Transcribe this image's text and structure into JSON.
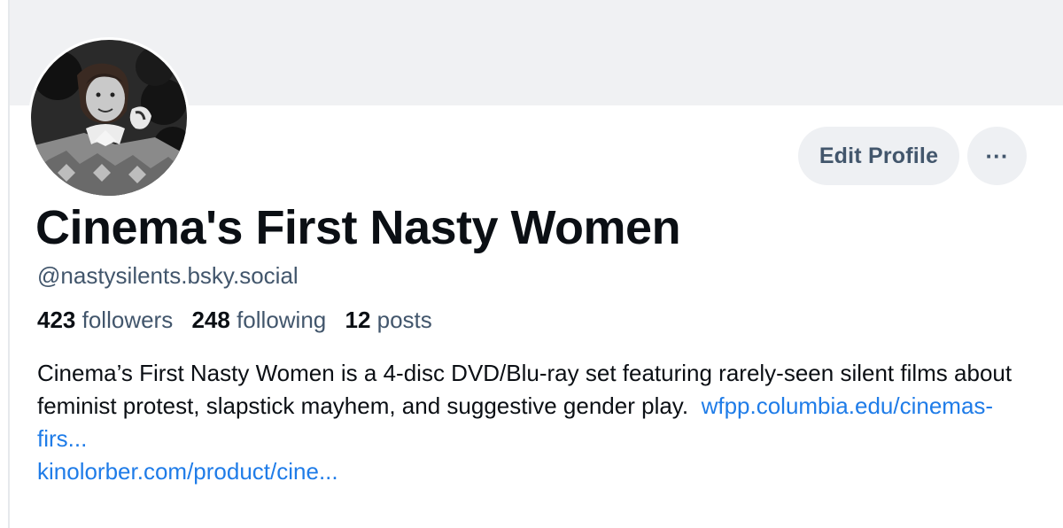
{
  "profile": {
    "display_name": "Cinema's First Nasty Women",
    "handle": "@nastysilents.bsky.social",
    "avatar_alt": "profile-photo"
  },
  "actions": {
    "edit_profile_label": "Edit Profile",
    "more_label": "···"
  },
  "stats": {
    "followers_count": "423",
    "followers_label": "followers",
    "following_count": "248",
    "following_label": "following",
    "posts_count": "12",
    "posts_label": "posts"
  },
  "bio": {
    "text": "Cinema’s First Nasty Women is a 4-disc DVD/Blu-ray set featuring rarely-seen silent films about feminist protest, slapstick mayhem, and suggestive gender play.",
    "links": [
      "wfpp.columbia.edu/cinemas-firs...",
      "kinolorber.com/product/cine..."
    ]
  },
  "colors": {
    "banner": "#f0f1f3",
    "text_primary": "#0b0f14",
    "text_secondary": "#42566c",
    "link": "#1f7ce8",
    "button_bg": "#eef0f3"
  }
}
